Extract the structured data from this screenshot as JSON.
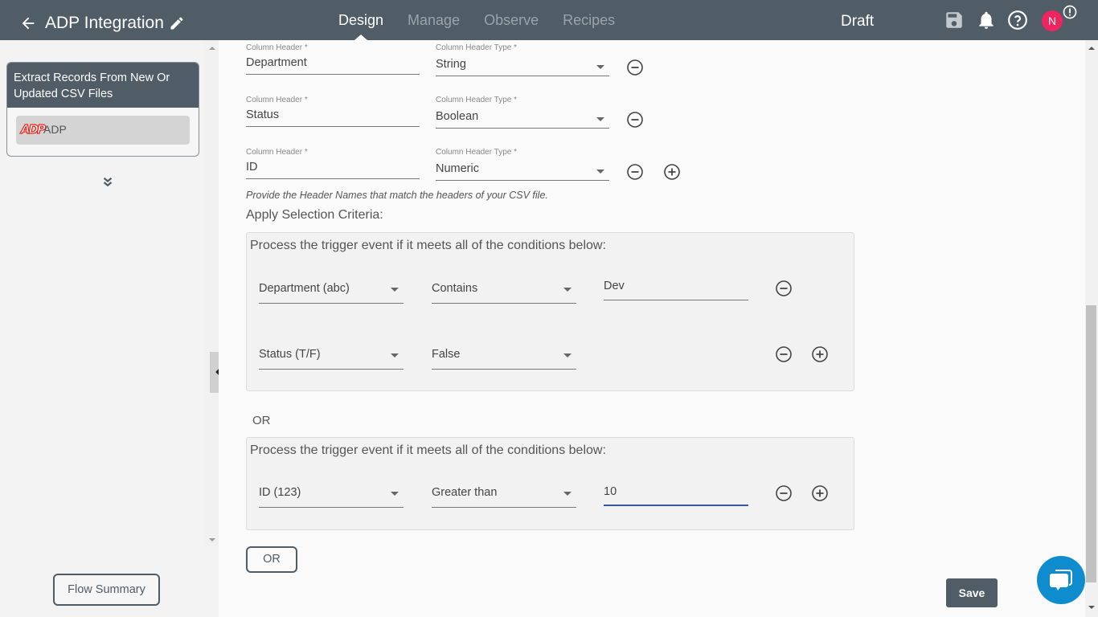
{
  "header": {
    "title": "ADP Integration",
    "tabs": [
      {
        "label": "Design",
        "active": true
      },
      {
        "label": "Manage",
        "active": false
      },
      {
        "label": "Observe",
        "active": false
      },
      {
        "label": "Recipes",
        "active": false
      }
    ],
    "status": "Draft",
    "icons": [
      "back-arrow-icon",
      "pencil-icon",
      "save-icon",
      "bell-icon",
      "help-icon",
      "alert-icon"
    ],
    "avatar_initial": "N",
    "avatar_color": "#f0245e",
    "bar_color": "#505c66"
  },
  "sidebar": {
    "trigger_title": "Extract Records From New Or Updated CSV Files",
    "connector_logo": "ADP",
    "connector_label": "ADP",
    "flow_summary_label": "Flow Summary"
  },
  "columns": {
    "header_label": "Column Header *",
    "type_label": "Column Header Type *",
    "rows": [
      {
        "header": "Department",
        "type": "String"
      },
      {
        "header": "Status",
        "type": "Boolean"
      },
      {
        "header": "ID",
        "type": "Numeric"
      }
    ],
    "hint": "Provide the Header Names that match the headers of your CSV file."
  },
  "criteria": {
    "title": "Apply Selection Criteria:",
    "groups": [
      {
        "title": "Process the trigger event if it meets all of the conditions below:",
        "conditions": [
          {
            "field": "Department (abc)",
            "operator": "Contains",
            "value": "Dev"
          },
          {
            "field": "Status (T/F)",
            "operator": "False",
            "value": null
          }
        ]
      },
      {
        "title": "Process the trigger event if it meets all of the conditions below:",
        "conditions": [
          {
            "field": "ID (123)",
            "operator": "Greater than",
            "value": "10"
          }
        ]
      }
    ],
    "or_label": "OR",
    "or_button_label": "OR"
  },
  "actions": {
    "save_label": "Save"
  }
}
